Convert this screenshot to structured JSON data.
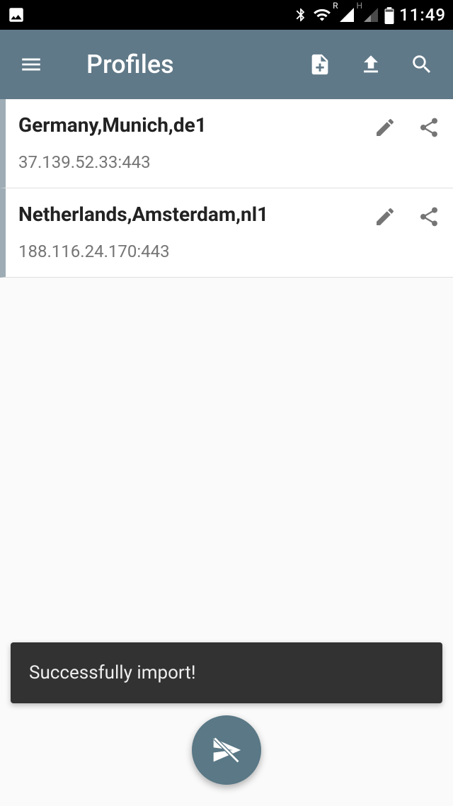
{
  "status": {
    "time": "11:49",
    "signal1_label": "R",
    "signal2_label": "H"
  },
  "header": {
    "title": "Profiles"
  },
  "profiles": [
    {
      "name": "Germany,Munich,de1",
      "address": "37.139.52.33:443"
    },
    {
      "name": "Netherlands,Amsterdam,nl1",
      "address": "188.116.24.170:443"
    }
  ],
  "snackbar": {
    "message": "Successfully import!"
  }
}
